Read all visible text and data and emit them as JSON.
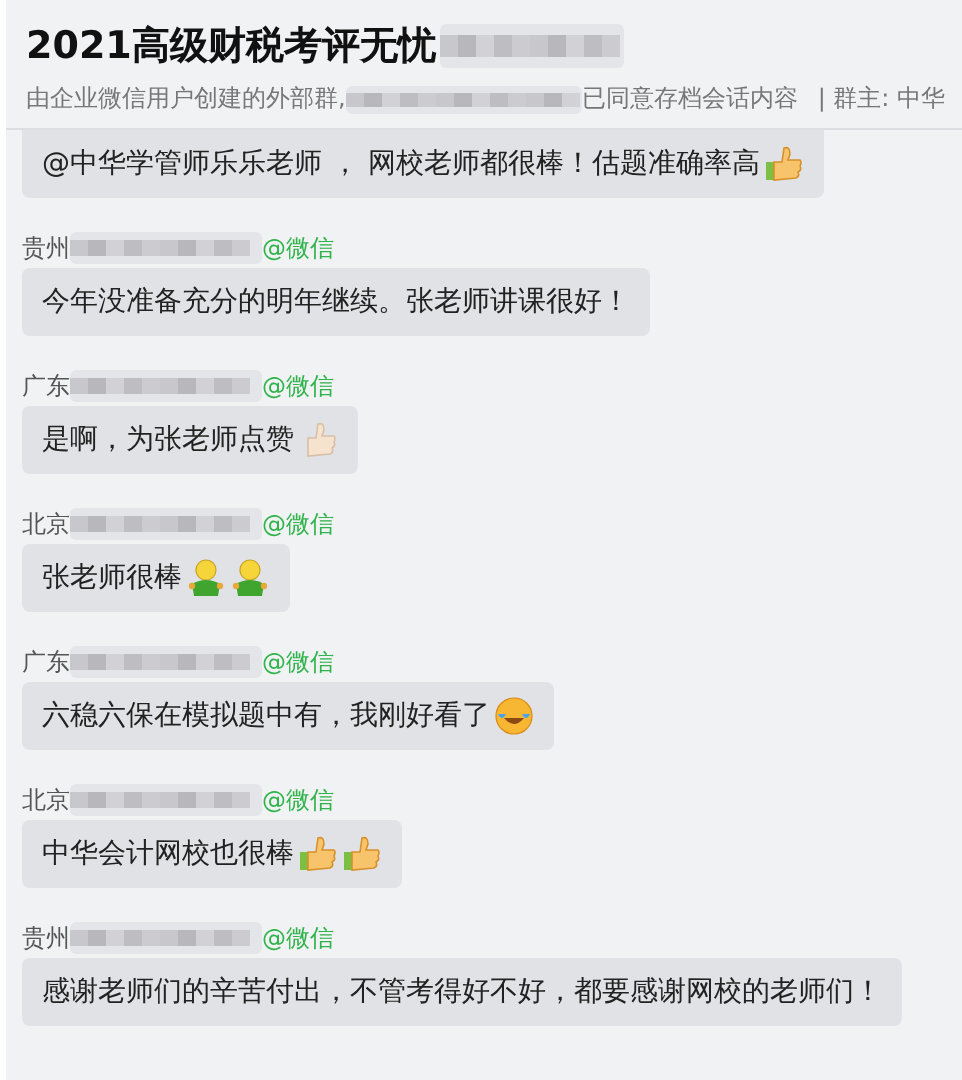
{
  "header": {
    "title": "2021高级财税考评无忧",
    "title_redacted": true,
    "subtitle_start": "由企业微信用户创建的外部群,",
    "subtitle_redacted": true,
    "subtitle_end": "已同意存档会话内容",
    "owner": "| 群主: 中华"
  },
  "messages": [
    {
      "text": "@中华学管师乐乐老师 ， 网校老师都很棒！估题准确率高",
      "emojis": [
        {
          "kind": "thumbs"
        }
      ]
    },
    {
      "sender": {
        "region": "贵州",
        "redacted": true,
        "source": "@微信"
      },
      "text": "今年没准备充分的明年继续。张老师讲课很好！"
    },
    {
      "sender": {
        "region": "广东",
        "redacted": true,
        "source": "@微信"
      },
      "text": "是啊，为张老师点赞",
      "emojis": [
        {
          "kind": "thumbs_light"
        }
      ]
    },
    {
      "sender": {
        "region": "北京",
        "redacted": true,
        "source": "@微信"
      },
      "text": "张老师很棒",
      "emojis": [
        {
          "kind": "figure"
        },
        {
          "kind": "figure"
        }
      ]
    },
    {
      "sender": {
        "region": "广东",
        "redacted": true,
        "source": "@微信"
      },
      "text": "六稳六保在模拟题中有，我刚好看了",
      "emojis": [
        {
          "kind": "laugh_cry"
        }
      ]
    },
    {
      "sender": {
        "region": "北京",
        "redacted": true,
        "source": "@微信"
      },
      "text": "中华会计网校也很棒",
      "emojis": [
        {
          "kind": "thumbs"
        },
        {
          "kind": "thumbs"
        }
      ]
    },
    {
      "sender": {
        "region": "贵州",
        "redacted": true,
        "source": "@微信"
      },
      "text": "感谢老师们的辛苦付出，不管考得好不好，都要感谢网校的老师们！"
    }
  ]
}
